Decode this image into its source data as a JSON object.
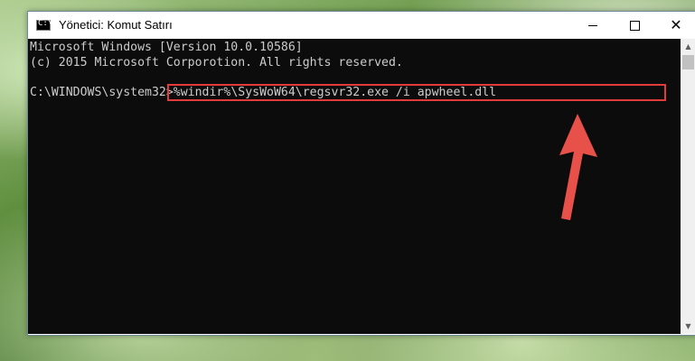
{
  "window": {
    "title": "Yönetici: Komut Satırı",
    "controls": {
      "minimize_icon": "minimize-icon",
      "maximize_icon": "maximize-icon",
      "close_icon": "close-icon"
    }
  },
  "console": {
    "line1": "Microsoft Windows [Version 10.0.10586]",
    "line2": "(c) 2015 Microsoft Corporotion. All rights reserved.",
    "prompt": "C:\\WINDOWS\\system32>",
    "command": "%windir%\\SysWoW64\\regsvr32.exe /i apwheel.dll"
  },
  "colors": {
    "console_bg": "#0c0c0c",
    "console_text": "#cccccc",
    "highlight": "#e23b3b",
    "arrow": "#e8514a"
  }
}
